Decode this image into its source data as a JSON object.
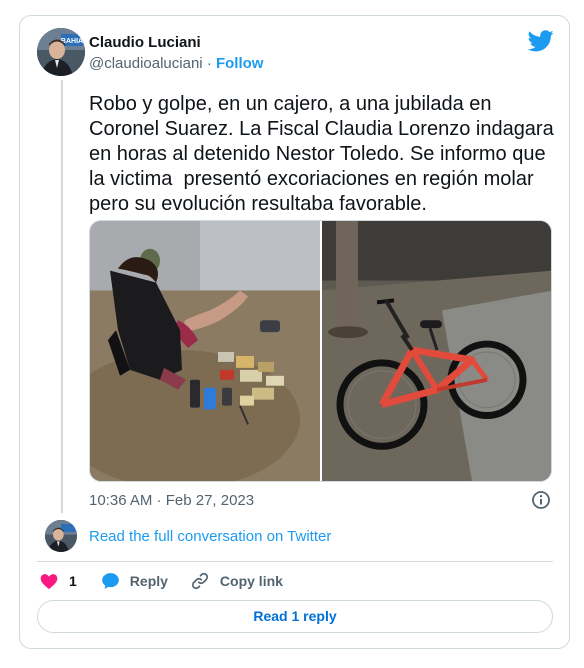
{
  "author": {
    "name": "Claudio Luciani",
    "handle": "@claudioaluciani",
    "separator": "·",
    "follow_label": "Follow",
    "avatar_text": "BAHIA"
  },
  "tweet": {
    "text": "Robo y golpe, en un cajero, a una jubilada en Coronel Suarez. La Fiscal Claudia Lorenzo indagara en horas al detenido Nestor Toledo. Se informo que la victima  presentó excoriaciones en región molar pero su evolución resultaba favorable.",
    "timestamp": "10:36 AM · Feb 27, 2023"
  },
  "conversation": {
    "read_full_label": "Read the full conversation on Twitter"
  },
  "actions": {
    "like_count": "1",
    "reply_label": "Reply",
    "copy_link_label": "Copy link"
  },
  "read_reply_label": "Read 1 reply",
  "colors": {
    "twitter_blue": "#1d9bf0",
    "like_pink": "#f91880",
    "text_primary": "#0f1419",
    "text_secondary": "#536471",
    "border": "#cfd9de"
  },
  "icons": {
    "brand": "twitter-bird-icon",
    "info": "info-icon",
    "like": "heart-icon",
    "reply": "reply-bubble-icon",
    "copy": "link-icon"
  }
}
